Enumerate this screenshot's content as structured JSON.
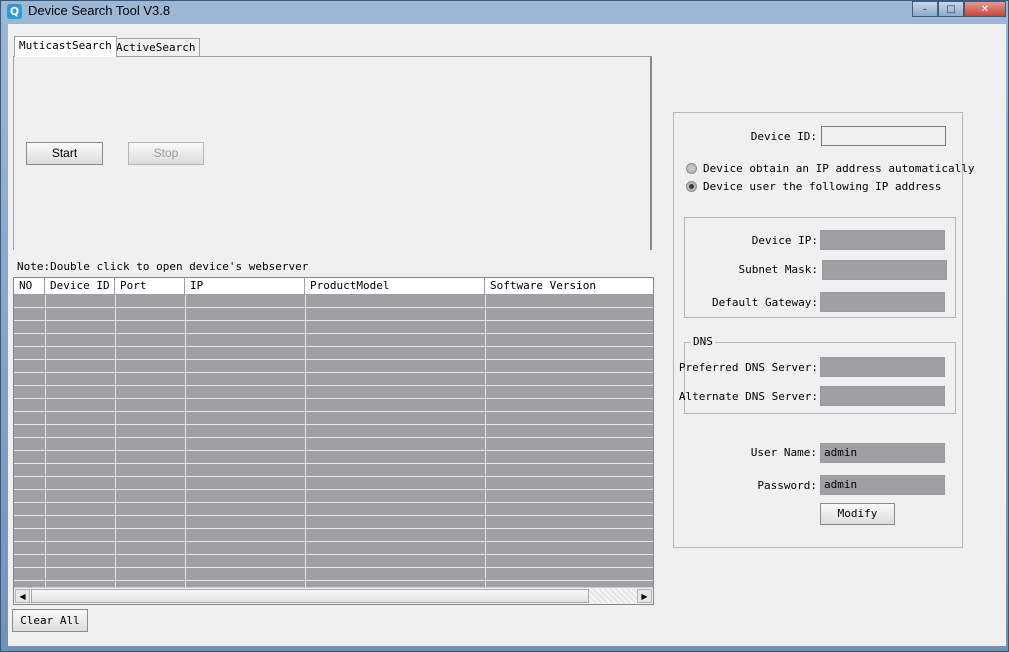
{
  "window": {
    "title": "Device Search Tool V3.8",
    "min_symbol": "–",
    "max_symbol": "□",
    "close_symbol": "✕"
  },
  "tabs": [
    {
      "label": "MuticastSearch",
      "selected": true
    },
    {
      "label": "ActiveSearch",
      "selected": false
    }
  ],
  "search": {
    "start_label": "Start",
    "stop_label": "Stop"
  },
  "note": "Note:Double click to open device's webserver",
  "table": {
    "columns": [
      "NO",
      "Device ID",
      "Port",
      "IP",
      "ProductModel",
      "Software Version"
    ],
    "rows": []
  },
  "clear_all_label": "Clear All",
  "device": {
    "device_id_label": "Device ID:",
    "device_id_value": "",
    "radio_auto_label": "Device obtain an IP address automatically",
    "radio_manual_label": "Device user the following IP address",
    "selected_mode": "manual",
    "device_ip_label": "Device IP:",
    "subnet_mask_label": "Subnet Mask:",
    "gateway_label": "Default Gateway:",
    "dns_group_title": "DNS",
    "preferred_dns_label": "Preferred DNS Server:",
    "alternate_dns_label": "Alternate DNS Server:",
    "username_label": "User Name:",
    "username_value": "admin",
    "password_label": "Password:",
    "password_value": "admin",
    "modify_label": "Modify"
  },
  "scrollbar": {
    "left_arrow": "◀",
    "right_arrow": "▶"
  }
}
